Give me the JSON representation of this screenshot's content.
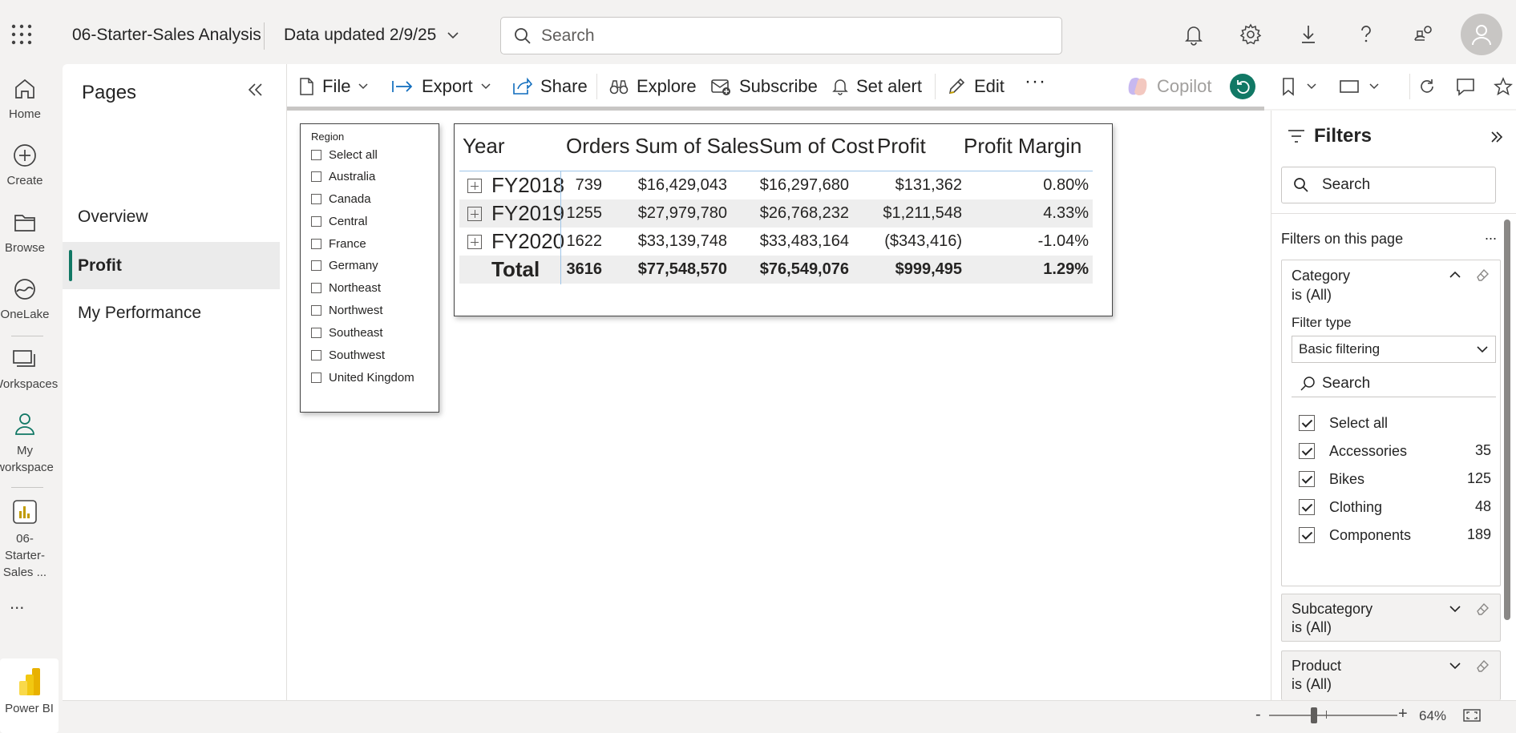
{
  "topbar": {
    "title": "06-Starter-Sales Analysis",
    "data_updated": "Data updated 2/9/25",
    "search_placeholder": "Search"
  },
  "leftnav": {
    "items": [
      {
        "label": "Home",
        "icon": "home-icon"
      },
      {
        "label": "Create",
        "icon": "create-icon"
      },
      {
        "label": "Browse",
        "icon": "browse-icon"
      },
      {
        "label": "OneLake",
        "icon": "onelake-icon"
      },
      {
        "label": "Workspaces",
        "icon": "workspaces-icon"
      },
      {
        "label": "My workspace",
        "icon": "my-workspace-icon"
      },
      {
        "label": "06-Starter-Sales ...",
        "icon": "report-icon"
      }
    ],
    "more": "...",
    "product": "Power BI"
  },
  "pages": {
    "title": "Pages",
    "items": [
      "Overview",
      "Profit",
      "My Performance"
    ],
    "active": "Profit"
  },
  "toolbar": {
    "file": "File",
    "export": "Export",
    "share": "Share",
    "explore": "Explore",
    "subscribe": "Subscribe",
    "set_alert": "Set alert",
    "edit": "Edit",
    "more": "···",
    "copilot": "Copilot"
  },
  "slicer": {
    "title": "Region",
    "items": [
      "Select all",
      "Australia",
      "Canada",
      "Central",
      "France",
      "Germany",
      "Northeast",
      "Northwest",
      "Southeast",
      "Southwest",
      "United Kingdom"
    ]
  },
  "matrix": {
    "headers": [
      "Year",
      "Orders",
      "Sum of Sales",
      "Sum of Cost",
      "Profit",
      "Profit Margin"
    ],
    "rows": [
      {
        "year": "FY2018",
        "orders": "739",
        "sales": "$16,429,043",
        "cost": "$16,297,680",
        "profit": "$131,362",
        "margin": "0.80%"
      },
      {
        "year": "FY2019",
        "orders": "1255",
        "sales": "$27,979,780",
        "cost": "$26,768,232",
        "profit": "$1,211,548",
        "margin": "4.33%"
      },
      {
        "year": "FY2020",
        "orders": "1622",
        "sales": "$33,139,748",
        "cost": "$33,483,164",
        "profit": "($343,416)",
        "margin": "-1.04%"
      }
    ],
    "total": {
      "year": "Total",
      "orders": "3616",
      "sales": "$77,548,570",
      "cost": "$76,549,076",
      "profit": "$999,495",
      "margin": "1.29%"
    }
  },
  "filters": {
    "title": "Filters",
    "search_placeholder": "Search",
    "section": "Filters on this page",
    "more": "...",
    "category": {
      "name": "Category",
      "state": "is (All)",
      "filter_type_label": "Filter type",
      "filter_type": "Basic filtering",
      "search_placeholder": "Search",
      "options": [
        {
          "label": "Select all",
          "count": ""
        },
        {
          "label": "Accessories",
          "count": "35"
        },
        {
          "label": "Bikes",
          "count": "125"
        },
        {
          "label": "Clothing",
          "count": "48"
        },
        {
          "label": "Components",
          "count": "189"
        }
      ]
    },
    "subcategory": {
      "name": "Subcategory",
      "state": "is (All)"
    },
    "product": {
      "name": "Product",
      "state": "is (All)"
    }
  },
  "status": {
    "zoom_minus": "-",
    "zoom_plus": "+",
    "zoom": "64%",
    "zoom_fraction": 0.35
  },
  "colors": {
    "accent": "#117865",
    "copilot_disabled": "#a19f9d"
  }
}
